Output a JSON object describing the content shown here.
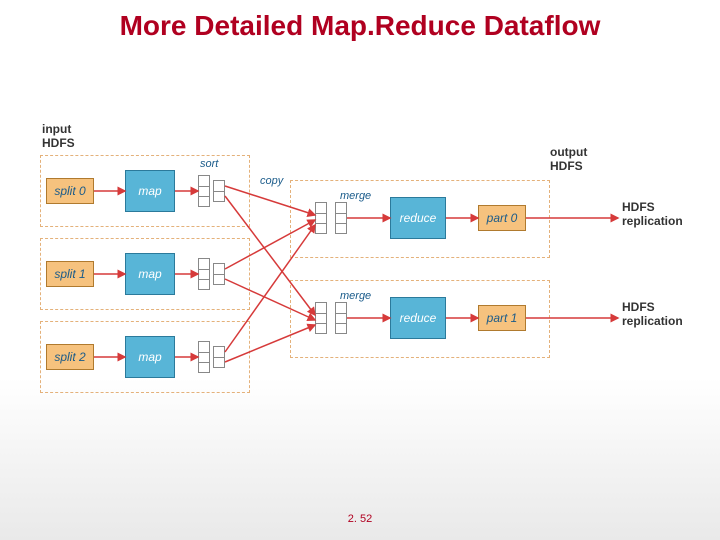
{
  "title": "More Detailed Map.Reduce Dataflow",
  "footer": "2. 52",
  "labels": {
    "input_hdfs": "input\nHDFS",
    "output_hdfs": "output\nHDFS",
    "sort": "sort",
    "copy": "copy",
    "merge0": "merge",
    "merge1": "merge",
    "hdfs_rep0": "HDFS\nreplication",
    "hdfs_rep1": "HDFS\nreplication"
  },
  "splits": [
    "split 0",
    "split 1",
    "split 2"
  ],
  "maps": [
    "map",
    "map",
    "map"
  ],
  "reduces": [
    "reduce",
    "reduce"
  ],
  "parts": [
    "part 0",
    "part 1"
  ]
}
